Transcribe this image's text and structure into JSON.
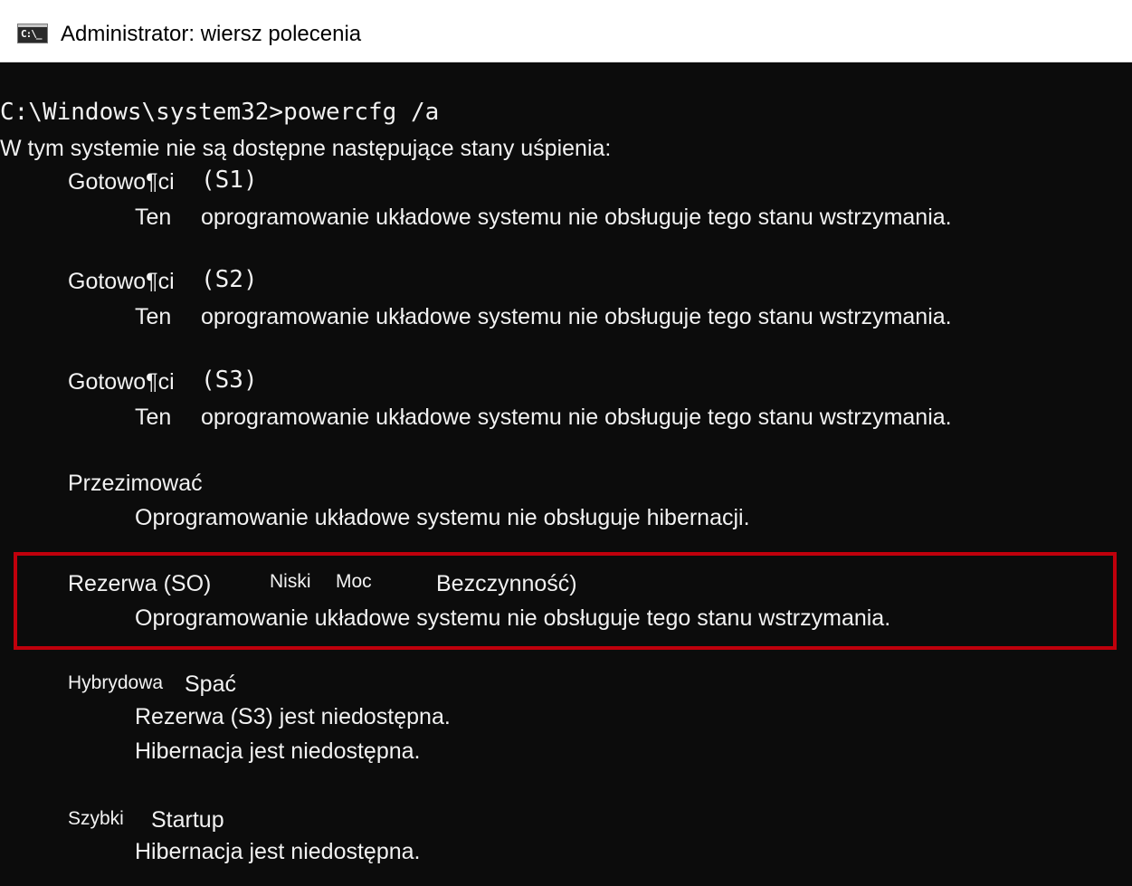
{
  "window": {
    "title": "Administrator: wiersz polecenia",
    "icon": "cmd-icon",
    "icon_glyph": "C:\\_"
  },
  "console": {
    "prompt": "C:\\Windows\\system32>powercfg /a",
    "intro": "W tym systemie nie są dostępne następujące stany uśpienia:",
    "s1": {
      "name": "Gotowo¶ci",
      "code": "(S1)",
      "desc_lead": "Ten",
      "desc": "oprogramowanie układowe systemu nie obsługuje tego stanu wstrzymania."
    },
    "s2": {
      "name": "Gotowo¶ci",
      "code": "(S2)",
      "desc_lead": "Ten",
      "desc": "oprogramowanie układowe systemu nie obsługuje tego stanu wstrzymania."
    },
    "s3": {
      "name": "Gotowo¶ci",
      "code": "(S3)",
      "desc_lead": "Ten",
      "desc": "oprogramowanie układowe systemu nie obsługuje tego stanu wstrzymania."
    },
    "hibernate": {
      "name": "Przezimować",
      "desc": "Oprogramowanie układowe systemu nie obsługuje hibernacji."
    },
    "s0": {
      "name_part1": "Rezerwa (SO)",
      "name_part2": "Niski",
      "name_part3": "Moc",
      "name_part4": "Bezczynność)",
      "desc": "Oprogramowanie układowe systemu nie obsługuje tego stanu wstrzymania."
    },
    "hybrid": {
      "name_part1": "Hybrydowa",
      "name_part2": "Spać",
      "desc1": "Rezerwa (S3) jest niedostępna.",
      "desc2": "Hibernacja jest niedostępna."
    },
    "faststartup": {
      "name_part1": "Szybki",
      "name_part2": "Startup",
      "desc": "Hibernacja jest niedostępna."
    }
  },
  "colors": {
    "console_background": "#0c0c0c",
    "console_text": "#f2f2f2",
    "titlebar_background": "#ffffff",
    "highlight_border": "#c0000c"
  }
}
